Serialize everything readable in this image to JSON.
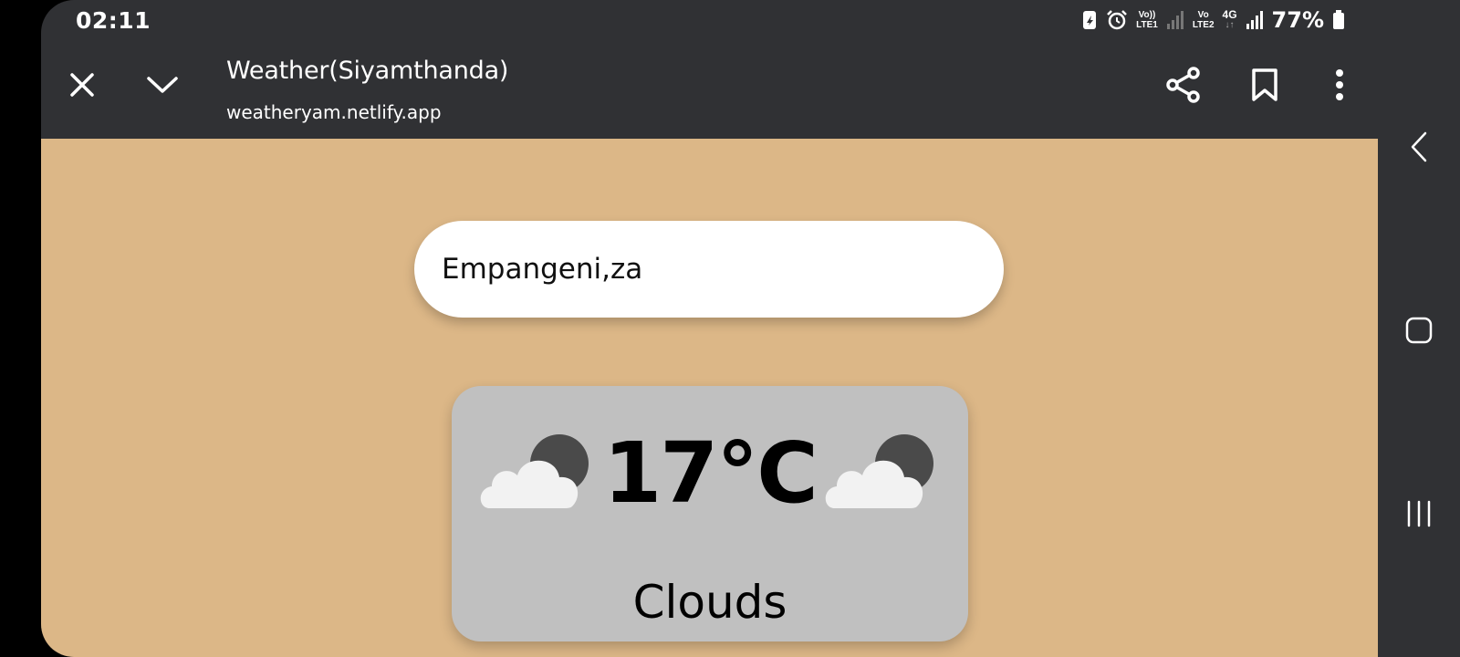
{
  "status_bar": {
    "time": "02:11",
    "network_1": "LTE1",
    "network_2": "LTE2",
    "network_type": "4G",
    "battery": "77%"
  },
  "browser": {
    "title": "Weather(Siyamthanda)",
    "url": "weatheryam.netlify.app",
    "icons": [
      "close-icon",
      "chevron-down-icon",
      "share-icon",
      "bookmark-icon",
      "more-vert-icon"
    ]
  },
  "weather": {
    "city_input_value": "Empangeni,za",
    "temperature": "17°C",
    "condition": "Clouds",
    "icon": "cloudy-night-icon"
  },
  "nav": {
    "icons": [
      "back-icon",
      "home-icon",
      "recents-icon"
    ]
  },
  "colors": {
    "page_bg": "#dcb787",
    "card_bg": "#c0c0c0",
    "chrome_bg": "#303134"
  }
}
